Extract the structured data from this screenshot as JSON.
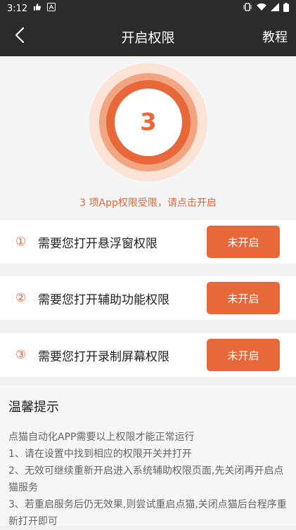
{
  "status_bar": {
    "time": "3:12"
  },
  "app_bar": {
    "title": "开启权限",
    "tutorial_label": "教程"
  },
  "hero": {
    "count": "3",
    "message": "3 项App权限受限，请点击开启"
  },
  "permissions": [
    {
      "num": "①",
      "text": "需要您打开悬浮窗权限",
      "button": "未开启"
    },
    {
      "num": "②",
      "text": "需要您打开辅助功能权限",
      "button": "未开启"
    },
    {
      "num": "③",
      "text": "需要您打开录制屏幕权限",
      "button": "未开启"
    }
  ],
  "tips": {
    "title": "温馨提示",
    "lines": [
      "点猫自动化APP需要以上权限才能正常运行",
      " 1、请在设置中找到相应的权限开关并打开",
      " 2、无效可继续重新开启进入系统辅助权限页面,先关闭再开启点猫服务",
      " 3、若重启服务后仍无效果,则尝试重启点猫,关闭点猫后台程序重新打开即可"
    ]
  },
  "colors": {
    "accent": "#e8683a",
    "bar": "#2b2b2b"
  }
}
